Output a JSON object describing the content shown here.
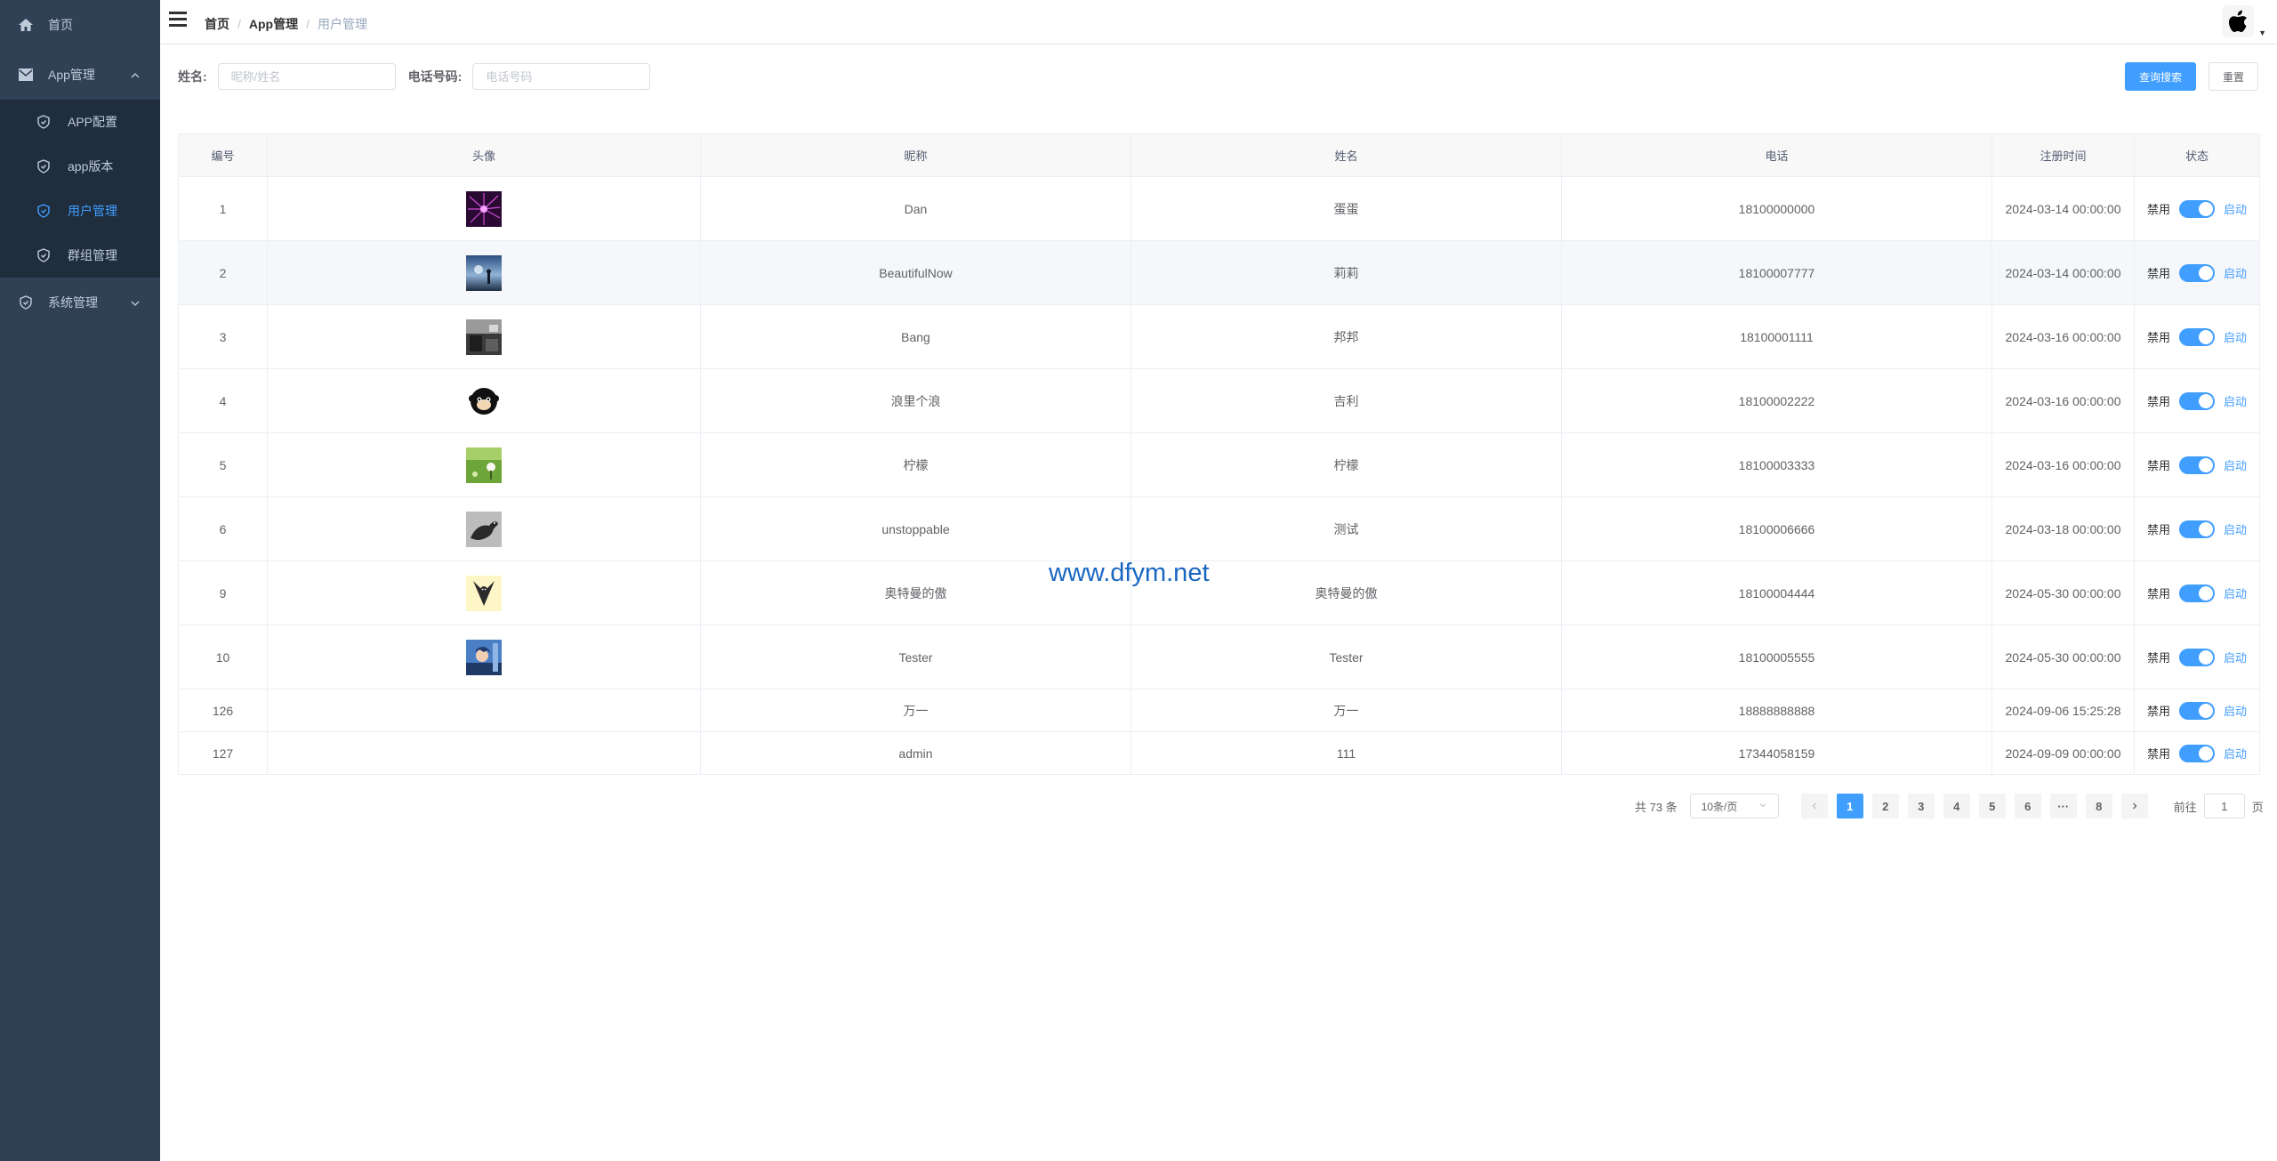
{
  "sidebar": {
    "items": [
      {
        "label": "首页",
        "icon": "home-icon"
      },
      {
        "label": "App管理",
        "icon": "mail-icon"
      },
      {
        "label": "系统管理",
        "icon": "shield-icon"
      }
    ],
    "sub_items": [
      {
        "label": "APP配置",
        "icon": "shield-icon"
      },
      {
        "label": "app版本",
        "icon": "shield-icon"
      },
      {
        "label": "用户管理",
        "icon": "shield-icon",
        "active": true
      },
      {
        "label": "群组管理",
        "icon": "shield-icon"
      }
    ]
  },
  "header": {
    "breadcrumb": [
      "首页",
      "App管理",
      "用户管理"
    ],
    "avatar_icon": "apple-icon"
  },
  "search": {
    "name_label": "姓名:",
    "name_placeholder": "昵称/姓名",
    "phone_label": "电话号码:",
    "phone_placeholder": "电话号码",
    "search_button": "查询搜索",
    "reset_button": "重置"
  },
  "table": {
    "columns": [
      "编号",
      "头像",
      "昵称",
      "姓名",
      "电话",
      "注册时间",
      "状态"
    ],
    "status_off_label": "禁用",
    "status_on_label": "启动",
    "rows": [
      {
        "id": "1",
        "nickname": "Dan",
        "name": "蛋蛋",
        "phone": "18100000000",
        "time": "2024-03-14 00:00:00",
        "avatar": "avatar-purple-fireworks"
      },
      {
        "id": "2",
        "nickname": "BeautifulNow",
        "name": "莉莉",
        "phone": "18100007777",
        "time": "2024-03-14 00:00:00",
        "avatar": "avatar-blue-sky"
      },
      {
        "id": "3",
        "nickname": "Bang",
        "name": "邦邦",
        "phone": "18100001111",
        "time": "2024-03-16 00:00:00",
        "avatar": "avatar-dark-room"
      },
      {
        "id": "4",
        "nickname": "浪里个浪",
        "name": "吉利",
        "phone": "18100002222",
        "time": "2024-03-16 00:00:00",
        "avatar": "avatar-black-monkey"
      },
      {
        "id": "5",
        "nickname": "柠檬",
        "name": "柠檬",
        "phone": "18100003333",
        "time": "2024-03-16 00:00:00",
        "avatar": "avatar-green-field"
      },
      {
        "id": "6",
        "nickname": "unstoppable",
        "name": "测试",
        "phone": "18100006666",
        "time": "2024-03-18 00:00:00",
        "avatar": "avatar-gray-panther"
      },
      {
        "id": "9",
        "nickname": "奥特曼的傲",
        "name": "奥特曼的傲",
        "phone": "18100004444",
        "time": "2024-05-30 00:00:00",
        "avatar": "avatar-yellow-figure"
      },
      {
        "id": "10",
        "nickname": "Tester",
        "name": "Tester",
        "phone": "18100005555",
        "time": "2024-05-30 00:00:00",
        "avatar": "avatar-anime-blue"
      },
      {
        "id": "126",
        "nickname": "万一",
        "name": "万一",
        "phone": "18888888888",
        "time": "2024-09-06 15:25:28",
        "avatar": ""
      },
      {
        "id": "127",
        "nickname": "admin",
        "name": "111",
        "phone": "17344058159",
        "time": "2024-09-09 00:00:00",
        "avatar": ""
      }
    ]
  },
  "pagination": {
    "total": "共 73 条",
    "page_size": "10条/页",
    "pages": [
      "1",
      "2",
      "3",
      "4",
      "5",
      "6",
      "···",
      "8"
    ],
    "current": "1",
    "jump_prefix": "前往",
    "jump_value": "1",
    "jump_suffix": "页"
  },
  "watermark": "www.dfym.net",
  "colors": {
    "sidebar_bg": "#304156",
    "submenu_bg": "#1f2d3d",
    "accent": "#409eff"
  }
}
